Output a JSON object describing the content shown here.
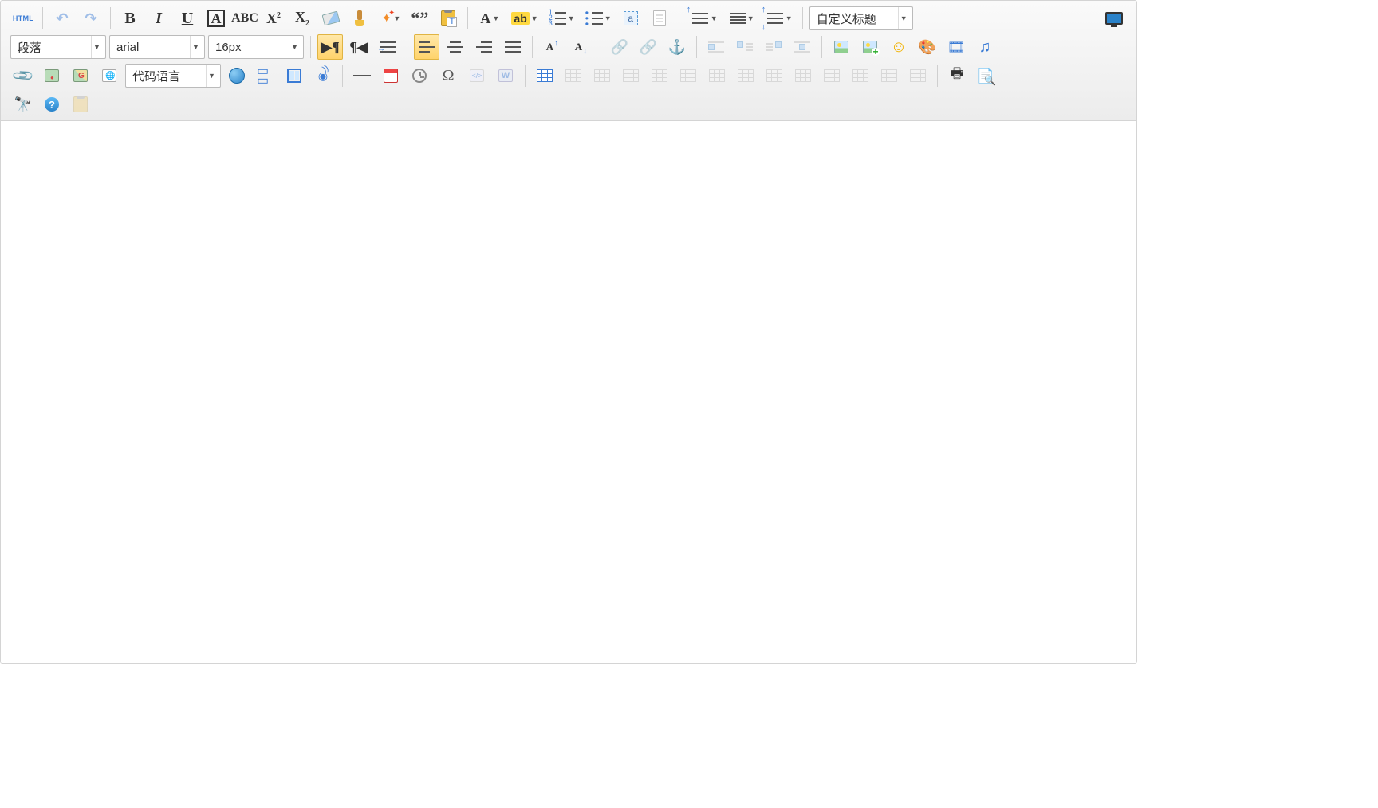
{
  "format": {
    "paragraph_select": "段落",
    "font_family": "arial",
    "font_size": "16px",
    "custom_title": "自定义标题"
  },
  "code_language": "代码语言",
  "icons": {
    "html": "HTML",
    "bold": "B",
    "italic": "I",
    "underline": "U",
    "fontborder": "A",
    "strike": "ABC",
    "sup": "X",
    "sub": "X",
    "quote": "“”",
    "forecolor": "A",
    "highlight": "ab",
    "selectall": "a",
    "omega": "Ω",
    "font_up": "A",
    "font_down": "A",
    "word": "W",
    "code": "</>"
  },
  "states": {
    "ltr_active": true,
    "align_left_active": true
  }
}
